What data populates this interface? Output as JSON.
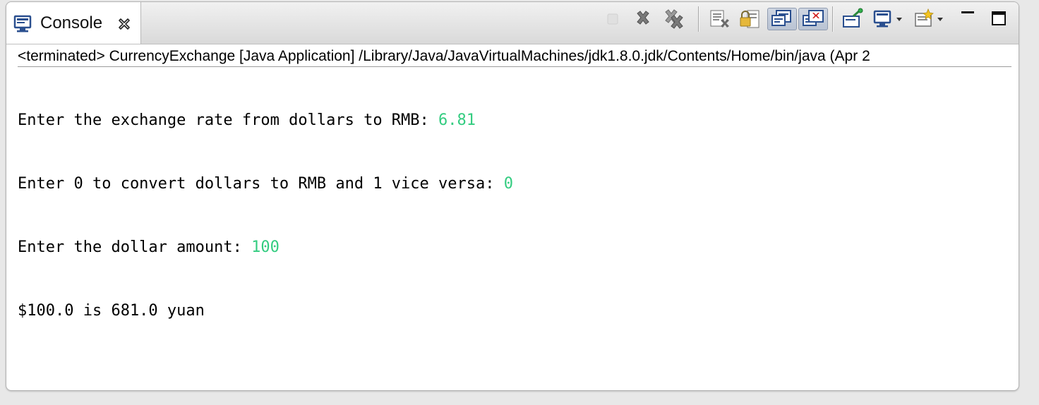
{
  "tab": {
    "icon": "console-icon",
    "label": "Console",
    "close_icon": "close-icon"
  },
  "toolbar": {
    "buttons": [
      {
        "name": "terminate-icon",
        "enabled": false
      },
      {
        "name": "remove-launch-icon",
        "enabled": true
      },
      {
        "name": "remove-all-terminated-icon",
        "enabled": true
      },
      {
        "name": "clear-console-icon",
        "enabled": true
      },
      {
        "name": "scroll-lock-icon",
        "enabled": true
      },
      {
        "name": "show-on-stdout-icon",
        "pressed": true
      },
      {
        "name": "show-on-stderr-icon",
        "pressed": true
      },
      {
        "name": "pin-console-icon",
        "enabled": true
      },
      {
        "name": "display-console-icon",
        "dropdown": true
      },
      {
        "name": "open-console-icon",
        "dropdown": true
      },
      {
        "name": "minimize-icon"
      },
      {
        "name": "maximize-icon"
      }
    ]
  },
  "status": {
    "text": "<terminated> CurrencyExchange [Java Application] /Library/Java/JavaVirtualMachines/jdk1.8.0.jdk/Contents/Home/bin/java (Apr 2"
  },
  "console": {
    "lines": [
      {
        "prompt": "Enter the exchange rate from dollars to RMB: ",
        "input": "6.81"
      },
      {
        "prompt": "Enter 0 to convert dollars to RMB and 1 vice versa: ",
        "input": "0"
      },
      {
        "prompt": "Enter the dollar amount: ",
        "input": "100"
      },
      {
        "prompt": "$100.0 is 681.0 yuan",
        "input": ""
      }
    ],
    "input_color": "#33cc80"
  }
}
